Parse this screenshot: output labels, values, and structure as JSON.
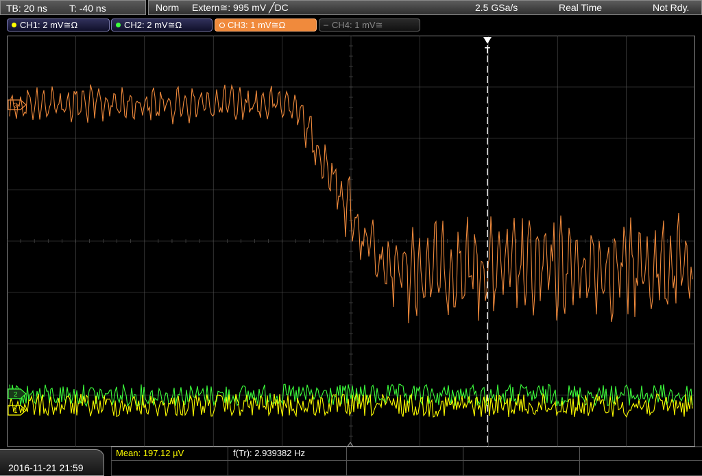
{
  "topbar": {
    "timebase": "TB: 20 ns",
    "trigger_time": "T: -40 ns",
    "trigger_mode": "Norm",
    "trigger_source": "Extern≅: 995 mV ╱DC",
    "sample_rate": "2.5 GSa/s",
    "acq_mode": "Real Time",
    "status": "Not Rdy."
  },
  "channels": [
    {
      "label": "CH1: 2 mV≅Ω",
      "color": "#ffff00",
      "active": true
    },
    {
      "label": "CH2: 2 mV≅Ω",
      "color": "#3cff3c",
      "active": true
    },
    {
      "label": "CH3: 1 mV≅Ω",
      "color": "#f08a3c",
      "active": true,
      "selected": true
    },
    {
      "label": "CH4: 1 mV≅",
      "color": "#666666",
      "active": false
    }
  ],
  "screen": {
    "ch3_marker": "3",
    "ch2_marker": "2",
    "ch1_marker": "1",
    "trigger_marker": "T",
    "colors": {
      "ch1": "#ffff00",
      "ch2": "#3cff3c",
      "ch3": "#f08a3c",
      "grid": "#555555"
    }
  },
  "bottom": {
    "datetime": "2016-11-21 21:59",
    "mean": "Mean: 197.12 µV",
    "freq": "f(Tr): 2.939382 Hz"
  }
}
